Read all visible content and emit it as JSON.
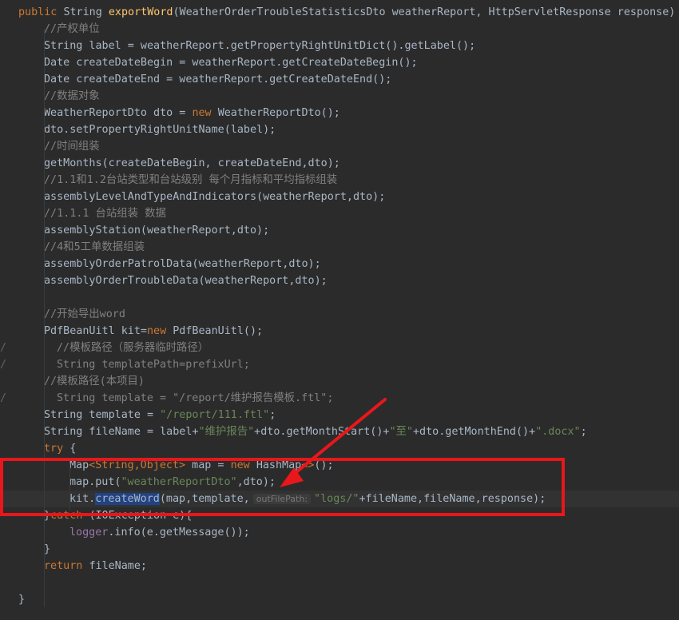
{
  "lines": [
    {
      "indent": 0,
      "tokens": [
        [
          "kw",
          "public "
        ],
        [
          "",
          "String "
        ],
        [
          "fn",
          "exportWord"
        ],
        [
          "",
          "(WeatherOrderTroubleStatisticsDto weatherReport, HttpServletResponse response) "
        ],
        [
          "kw",
          "t"
        ]
      ]
    },
    {
      "indent": 1,
      "tokens": [
        [
          "cm",
          "//产权单位"
        ]
      ]
    },
    {
      "indent": 1,
      "tokens": [
        [
          "",
          "String label = weatherReport.getPropertyRightUnitDict().getLabel();"
        ]
      ]
    },
    {
      "indent": 1,
      "tokens": [
        [
          "",
          "Date createDateBegin = weatherReport.getCreateDateBegin();"
        ]
      ]
    },
    {
      "indent": 1,
      "tokens": [
        [
          "",
          "Date createDateEnd = weatherReport.getCreateDateEnd();"
        ]
      ]
    },
    {
      "indent": 1,
      "tokens": [
        [
          "cm",
          "//数据对象"
        ]
      ]
    },
    {
      "indent": 1,
      "tokens": [
        [
          "",
          "WeatherReportDto dto = "
        ],
        [
          "kw",
          "new "
        ],
        [
          "",
          "WeatherReportDto();"
        ]
      ]
    },
    {
      "indent": 1,
      "tokens": [
        [
          "",
          "dto.setPropertyRightUnitName(label);"
        ]
      ]
    },
    {
      "indent": 1,
      "tokens": [
        [
          "cm",
          "//时间组装"
        ]
      ]
    },
    {
      "indent": 1,
      "tokens": [
        [
          "",
          "getMonths(createDateBegin, createDateEnd,dto);"
        ]
      ]
    },
    {
      "indent": 1,
      "tokens": [
        [
          "cm",
          "//1.1和1.2台站类型和台站级别 每个月指标和平均指标组装"
        ]
      ]
    },
    {
      "indent": 1,
      "tokens": [
        [
          "",
          "assemblyLevelAndTypeAndIndicators(weatherReport,dto);"
        ]
      ]
    },
    {
      "indent": 1,
      "tokens": [
        [
          "cm",
          "//1.1.1 台站组装 数据"
        ]
      ]
    },
    {
      "indent": 1,
      "tokens": [
        [
          "",
          "assemblyStation(weatherReport,dto);"
        ]
      ]
    },
    {
      "indent": 1,
      "tokens": [
        [
          "cm",
          "//4和5工单数据组装"
        ]
      ]
    },
    {
      "indent": 1,
      "tokens": [
        [
          "",
          "assemblyOrderPatrolData(weatherReport,dto);"
        ]
      ]
    },
    {
      "indent": 1,
      "tokens": [
        [
          "",
          "assemblyOrderTroubleData(weatherReport,dto);"
        ]
      ]
    },
    {
      "indent": 1,
      "tokens": []
    },
    {
      "indent": 1,
      "tokens": [
        [
          "cm",
          "//开始导出word"
        ]
      ]
    },
    {
      "indent": 1,
      "tokens": [
        [
          "",
          "PdfBeanUitl kit="
        ],
        [
          "kw",
          "new "
        ],
        [
          "",
          "PdfBeanUitl();"
        ]
      ]
    },
    {
      "indent": 1,
      "gutter": "/",
      "extra": 16,
      "tokens": [
        [
          "cm",
          "//模板路径（服务器临时路径）"
        ]
      ]
    },
    {
      "indent": 1,
      "gutter": "/",
      "extra": 16,
      "tokens": [
        [
          "cm",
          "String templatePath=prefixUrl;"
        ]
      ]
    },
    {
      "indent": 1,
      "tokens": [
        [
          "cm",
          "//模板路径(本项目)"
        ]
      ]
    },
    {
      "indent": 1,
      "gutter": "/",
      "extra": 16,
      "tokens": [
        [
          "cm",
          "String template = \"/report/维护报告模板.ftl\";"
        ]
      ]
    },
    {
      "indent": 1,
      "tokens": [
        [
          "",
          "String template = "
        ],
        [
          "st",
          "\"/report/111.ftl\""
        ],
        [
          "",
          ";"
        ]
      ]
    },
    {
      "indent": 1,
      "tokens": [
        [
          "",
          "String fileName = label+"
        ],
        [
          "st",
          "\"维护报告\""
        ],
        [
          "",
          "+dto.getMonthStart()+"
        ],
        [
          "st",
          "\"至\""
        ],
        [
          "",
          "+dto.getMonthEnd()+"
        ],
        [
          "st",
          "\".docx\""
        ],
        [
          "",
          ";"
        ]
      ]
    },
    {
      "indent": 1,
      "tokens": [
        [
          "kw",
          "try "
        ],
        [
          "",
          "{"
        ]
      ]
    },
    {
      "indent": 2,
      "tokens": [
        [
          "",
          "Map"
        ],
        [
          "gen",
          "<String,Object>"
        ],
        [
          "",
          " map = "
        ],
        [
          "kw",
          "new "
        ],
        [
          "",
          "HashMap"
        ],
        [
          "gen",
          "<>"
        ],
        [
          "",
          "();"
        ]
      ]
    },
    {
      "indent": 2,
      "tokens": [
        [
          "",
          "map.put("
        ],
        [
          "st",
          "\"weatherReportDto\""
        ],
        [
          "",
          ",dto);"
        ]
      ]
    },
    {
      "indent": 2,
      "caret": true,
      "tokens": [
        [
          "",
          "kit."
        ],
        [
          "hl",
          "createWord"
        ],
        [
          "",
          "(map,template,"
        ],
        [
          "hint",
          "outFilePath:"
        ],
        [
          "st",
          "\"logs/\""
        ],
        [
          "",
          "+fileName,fileName,response);"
        ]
      ]
    },
    {
      "indent": 1,
      "tokens": [
        [
          "",
          "}"
        ],
        [
          "kw",
          "catch "
        ],
        [
          "",
          "(IOException e){"
        ]
      ]
    },
    {
      "indent": 2,
      "tokens": [
        [
          "pp",
          "logger"
        ],
        [
          "",
          ".info(e.getMessage());"
        ]
      ]
    },
    {
      "indent": 1,
      "tokens": [
        [
          "",
          "}"
        ]
      ]
    },
    {
      "indent": 1,
      "tokens": [
        [
          "kw",
          "return "
        ],
        [
          "",
          "fileName;"
        ]
      ]
    },
    {
      "indent": 0,
      "tokens": []
    },
    {
      "indent": 0,
      "tokens": [
        [
          "",
          "}"
        ]
      ]
    }
  ]
}
